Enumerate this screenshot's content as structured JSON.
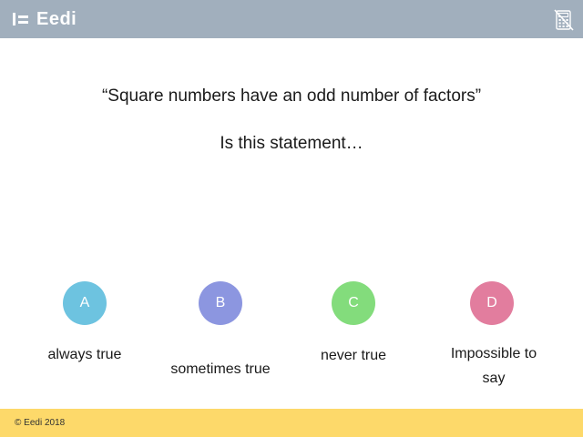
{
  "header": {
    "logo_text": "Eedi",
    "calculator_icon": "calculator-not-allowed-icon",
    "background": "#a1afbd"
  },
  "question": {
    "statement": "“Square numbers have an odd number of factors”",
    "prompt": "Is this statement…"
  },
  "options": [
    {
      "letter": "A",
      "label": "always true",
      "color": "#6dc3e0"
    },
    {
      "letter": "B",
      "label": "sometimes true",
      "color": "#8c96e0"
    },
    {
      "letter": "C",
      "label": "never true",
      "color": "#83dc7c"
    },
    {
      "letter": "D",
      "label": "Impossible to say",
      "color": "#e27d9e"
    }
  ],
  "footer": {
    "copyright": "© Eedi 2018",
    "background": "#fdd96a"
  }
}
